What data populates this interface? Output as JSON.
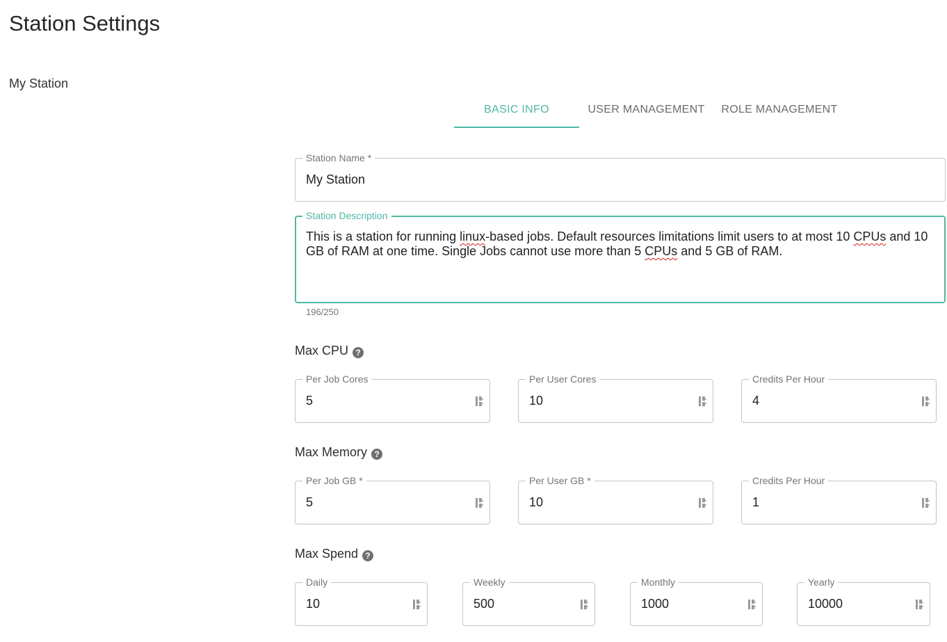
{
  "page": {
    "title": "Station Settings",
    "station_label": "My Station"
  },
  "tabs": [
    {
      "label": "BASIC INFO",
      "active": true
    },
    {
      "label": "USER MANAGEMENT",
      "active": false
    },
    {
      "label": "ROLE MANAGEMENT",
      "active": false
    }
  ],
  "station_name": {
    "label": "Station Name *",
    "value": "My Station"
  },
  "station_description": {
    "label": "Station Description",
    "value_part1": "This is a station for running ",
    "value_w1": "linux",
    "value_part2": "-based jobs. Default resources limitations limit users to at most 10 ",
    "value_w2": "CPUs",
    "value_part3": " and 10 GB of RAM at one time. Single Jobs cannot use more than 5 ",
    "value_w3": "CPUs",
    "value_part4": " and 5 GB of RAM.",
    "counter": "196/250"
  },
  "max_cpu": {
    "title": "Max CPU",
    "help_icon": "?",
    "fields": [
      {
        "label": "Per Job Cores",
        "value": "5"
      },
      {
        "label": "Per User Cores",
        "value": "10"
      },
      {
        "label": "Credits Per Hour",
        "value": "4"
      }
    ]
  },
  "max_memory": {
    "title": "Max Memory",
    "help_icon": "?",
    "fields": [
      {
        "label": "Per Job GB *",
        "value": "5"
      },
      {
        "label": "Per User GB *",
        "value": "10"
      },
      {
        "label": "Credits Per Hour",
        "value": "1"
      }
    ]
  },
  "max_spend": {
    "title": "Max Spend",
    "help_icon": "?",
    "fields": [
      {
        "label": "Daily",
        "value": "10"
      },
      {
        "label": "Weekly",
        "value": "500"
      },
      {
        "label": "Monthly",
        "value": "1000"
      },
      {
        "label": "Yearly",
        "value": "10000"
      }
    ]
  },
  "colors": {
    "accent": "#4fb8a4",
    "border": "#c4c4c4",
    "help_icon_bg": "#6f6f6f"
  },
  "icons": {
    "spinner": "number-spinner-icon",
    "help": "help-circle-icon"
  }
}
